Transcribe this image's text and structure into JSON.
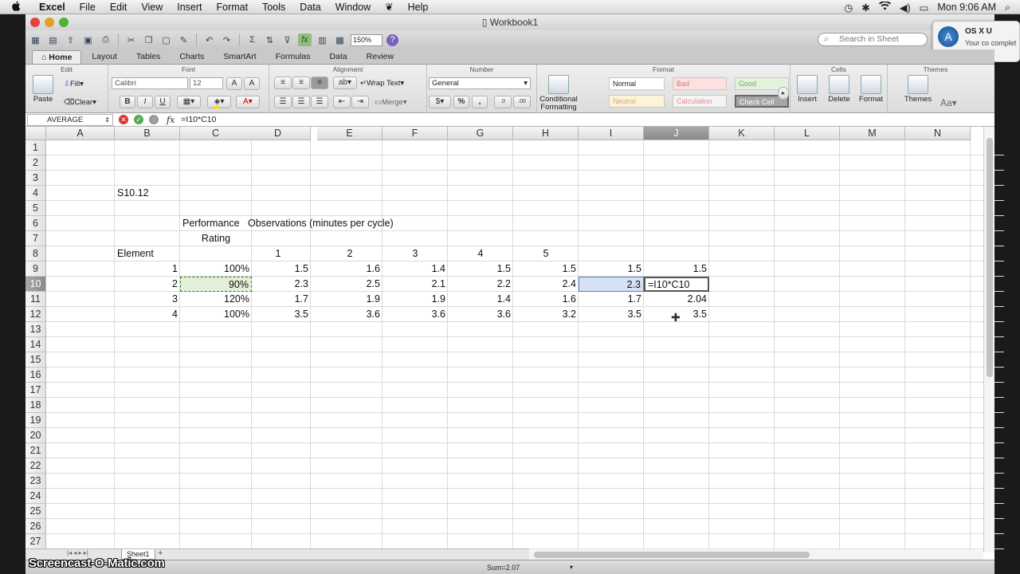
{
  "menubar": {
    "apple": "",
    "items": [
      "Excel",
      "File",
      "Edit",
      "View",
      "Insert",
      "Format",
      "Tools",
      "Data",
      "Window",
      "Help"
    ],
    "clock": "Mon 9:06 AM"
  },
  "window": {
    "title": "Workbook1"
  },
  "toolbar": {
    "zoom": "150%",
    "search_placeholder": "Search in Sheet"
  },
  "notification": {
    "title": "OS X U",
    "body": "Your co complet"
  },
  "ribbon_tabs": [
    "Home",
    "Layout",
    "Tables",
    "Charts",
    "SmartArt",
    "Formulas",
    "Data",
    "Review"
  ],
  "ribbon": {
    "groups": [
      "Edit",
      "Font",
      "Alignment",
      "Number",
      "Format",
      "Cells",
      "Themes"
    ],
    "paste": "Paste",
    "fill": "Fill",
    "clear": "Clear",
    "font_name": "Calibri",
    "font_size": "12",
    "wrap_text": "Wrap Text",
    "merge": "Merge",
    "number_format": "General",
    "conditional": "Conditional Formatting",
    "styles": {
      "normal": "Normal",
      "bad": "Bad",
      "good": "Good",
      "neutral": "Neutral",
      "calculation": "Calculation",
      "check": "Check Cell"
    },
    "insert": "Insert",
    "delete": "Delete",
    "format": "Format",
    "themes": "Themes"
  },
  "formula_bar": {
    "name_box": "AVERAGE",
    "fx": "fx",
    "formula": "=I10*C10"
  },
  "columns": [
    "A",
    "B",
    "C",
    "D",
    "E",
    "F",
    "G",
    "H",
    "I",
    "J",
    "K",
    "L",
    "M",
    "N"
  ],
  "selected_column": "J",
  "selected_row": "10",
  "rows": [
    "1",
    "2",
    "3",
    "4",
    "5",
    "6",
    "7",
    "8",
    "9",
    "10",
    "11",
    "12",
    "13",
    "14",
    "15",
    "16",
    "17",
    "18",
    "19",
    "20",
    "21",
    "22",
    "23",
    "24",
    "25",
    "26",
    "27"
  ],
  "cells": {
    "B4": "S10.12",
    "C6": "Performance",
    "C7": "Rating",
    "D6": "Observations (minutes per cycle)",
    "B8": "Element",
    "D8": "1",
    "E8": "2",
    "F8": "3",
    "G8": "4",
    "H8": "5",
    "B9": "1",
    "C9": "100%",
    "D9": "1.5",
    "E9": "1.6",
    "F9": "1.4",
    "G9": "1.5",
    "H9": "1.5",
    "I9": "1.5",
    "J9": "1.5",
    "B10": "2",
    "C10": "90%",
    "D10": "2.3",
    "E10": "2.5",
    "F10": "2.1",
    "G10": "2.2",
    "H10": "2.4",
    "I10": "2.3",
    "J10": "=I10*C10",
    "B11": "3",
    "C11": "120%",
    "D11": "1.7",
    "E11": "1.9",
    "F11": "1.9",
    "G11": "1.4",
    "H11": "1.6",
    "I11": "1.7",
    "J11": "2.04",
    "B12": "4",
    "C12": "100%",
    "D12": "3.5",
    "E12": "3.6",
    "F12": "3.6",
    "G12": "3.6",
    "H12": "3.2",
    "I12": "3.5",
    "J12": "3.5"
  },
  "sheet_tab": "Sheet1",
  "status": {
    "sum": "Sum=2.07"
  },
  "watermark": "Screencast-O-Matic.com"
}
